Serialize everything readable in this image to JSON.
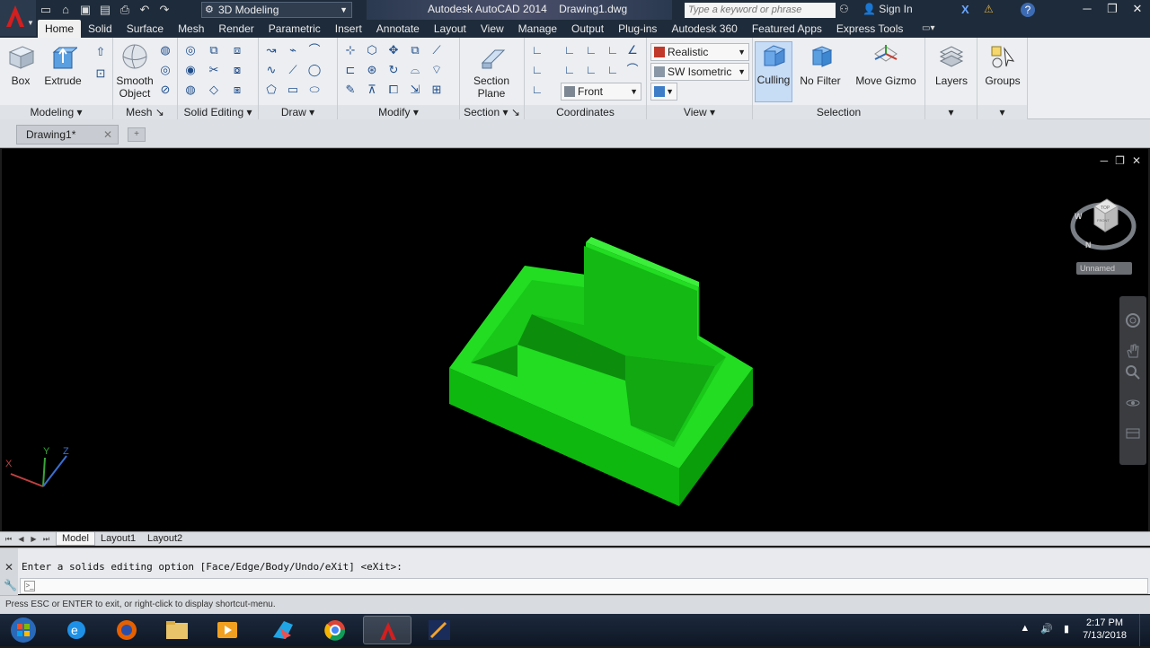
{
  "app": {
    "title": "Autodesk AutoCAD 2014",
    "document": "Drawing1.dwg",
    "workspace": "3D Modeling",
    "search_placeholder": "Type a keyword or phrase",
    "sign_in": "Sign In"
  },
  "ribbon_tabs": [
    "Home",
    "Solid",
    "Surface",
    "Mesh",
    "Render",
    "Parametric",
    "Insert",
    "Annotate",
    "Layout",
    "View",
    "Manage",
    "Output",
    "Plug-ins",
    "Autodesk 360",
    "Featured Apps",
    "Express Tools"
  ],
  "active_tab": "Home",
  "panels": {
    "modeling": {
      "title": "Modeling",
      "box": "Box",
      "extrude": "Extrude"
    },
    "mesh": {
      "title": "Mesh",
      "smooth_object_1": "Smooth",
      "smooth_object_2": "Object"
    },
    "solid_editing": {
      "title": "Solid Editing"
    },
    "draw": {
      "title": "Draw"
    },
    "modify": {
      "title": "Modify"
    },
    "section": {
      "title": "Section",
      "section_plane_1": "Section",
      "section_plane_2": "Plane"
    },
    "coordinates": {
      "title": "Coordinates"
    },
    "view": {
      "title": "View",
      "visual_style": "Realistic",
      "view_direction": "SW Isometric",
      "ucs_view": "Front"
    },
    "selection": {
      "title": "Selection",
      "culling": "Culling",
      "no_filter": "No Filter",
      "move_gizmo": "Move Gizmo"
    },
    "layers": {
      "label": "Layers"
    },
    "groups": {
      "label": "Groups"
    }
  },
  "doc_tab": "Drawing1*",
  "viewcube": {
    "named_view": "Unnamed",
    "compass_n": "N",
    "compass_w": "W",
    "top_face": "TOP",
    "front_face": "FRONT"
  },
  "ucs_icon": {
    "x": "X",
    "y": "Y",
    "z": "Z"
  },
  "layout_tabs": [
    "Model",
    "Layout1",
    "Layout2"
  ],
  "active_layout": "Model",
  "command": {
    "history": "Enter a solids editing option [Face/Edge/Body/Undo/eXit] <eXit>:",
    "input": ""
  },
  "status_text": "Press ESC or ENTER to exit, or right-click to display shortcut-menu.",
  "clock": {
    "time": "2:17 PM",
    "date": "7/13/2018"
  },
  "colors": {
    "model_green": "#17d417",
    "ribbon_bg": "#eceef1",
    "titlebar": "#1e2b3a"
  }
}
